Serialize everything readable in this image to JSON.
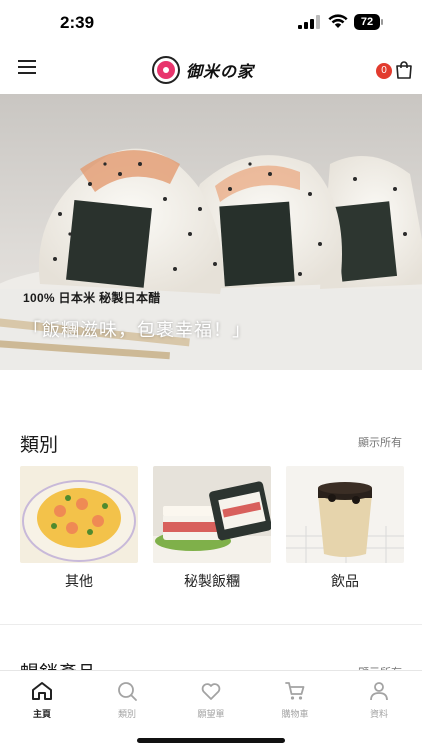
{
  "status_bar": {
    "time": "2:39",
    "battery": "72"
  },
  "header": {
    "logo_text": "御米の家",
    "cart_count": "0"
  },
  "hero": {
    "tag": "100% 日本米 秘製日本醋",
    "slogan": "「飯糰滋味，包裹幸福！」"
  },
  "categories": {
    "title": "類別",
    "show_all": "顯示所有",
    "items": [
      {
        "label": "其他"
      },
      {
        "label": "秘製飯糰"
      },
      {
        "label": "飲品"
      }
    ]
  },
  "best_sellers": {
    "title": "暢銷產品",
    "show_all": "顯示所有"
  },
  "tab_bar": {
    "items": [
      {
        "label": "主頁",
        "icon": "home-icon",
        "active": true
      },
      {
        "label": "類別",
        "icon": "search-icon",
        "active": false
      },
      {
        "label": "願望單",
        "icon": "heart-icon",
        "active": false
      },
      {
        "label": "購物車",
        "icon": "cart-icon",
        "active": false
      },
      {
        "label": "資料",
        "icon": "user-icon",
        "active": false
      }
    ]
  },
  "colors": {
    "accent": "#e8356d",
    "badge": "#e23b2e",
    "active_tab": "#222222",
    "inactive_tab": "#a3a3a3"
  }
}
